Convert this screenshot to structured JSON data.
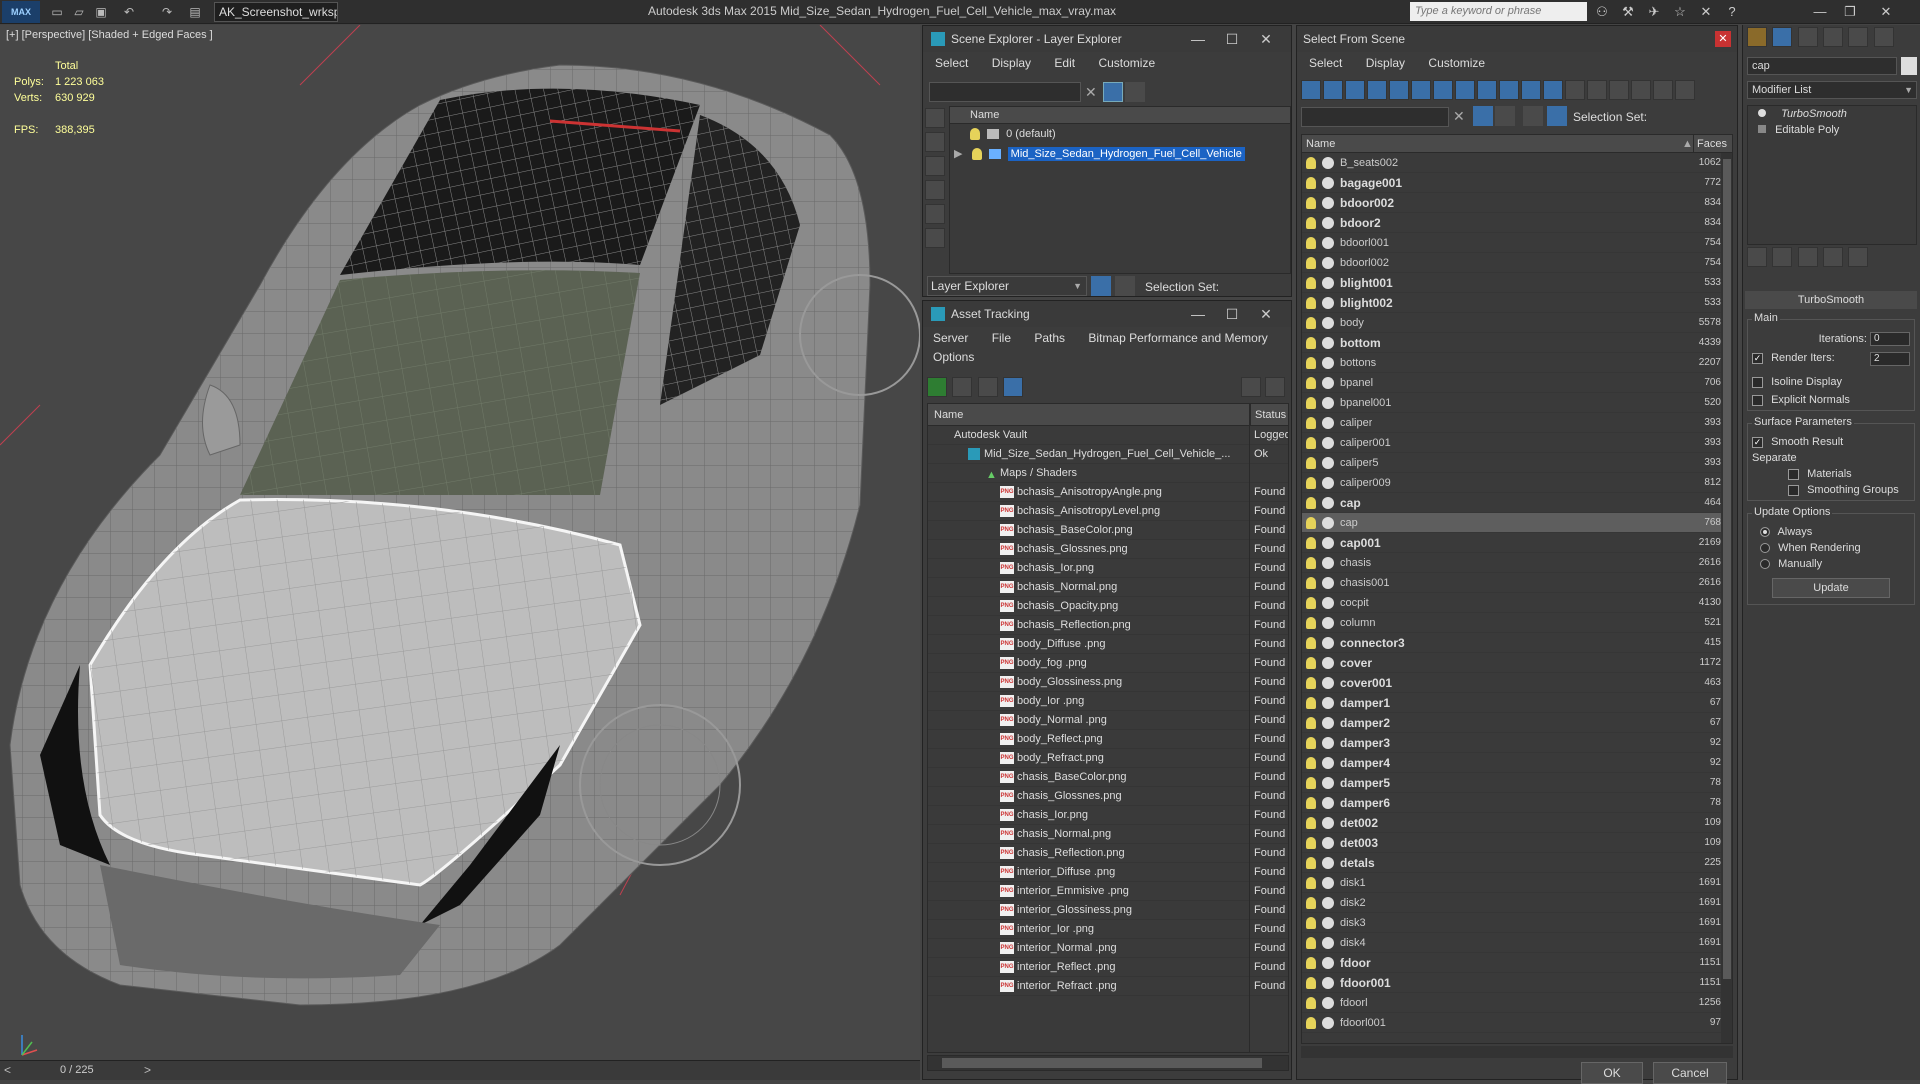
{
  "app": {
    "logo": "MAX",
    "workspace": "AK_Screenshot_wrksp",
    "title": "Autodesk 3ds Max  2015    Mid_Size_Sedan_Hydrogen_Fuel_Cell_Vehicle_max_vray.max",
    "search_placeholder": "Type a keyword or phrase"
  },
  "viewport": {
    "label": "[+] [Perspective] [Shaded + Edged Faces ]",
    "stats": {
      "total_label": "Total",
      "polys_label": "Polys:",
      "polys_value": "1 223 063",
      "verts_label": "Verts:",
      "verts_value": "630 929",
      "fps_label": "FPS:",
      "fps_value": "388,395"
    },
    "timeline": "0 / 225",
    "prev": "<",
    "next": ">"
  },
  "scene_explorer": {
    "title": "Scene Explorer - Layer Explorer",
    "menu": [
      "Select",
      "Display",
      "Edit",
      "Customize"
    ],
    "col_name": "Name",
    "layers": [
      {
        "label": "0 (default)",
        "selected": false
      },
      {
        "label": "Mid_Size_Sedan_Hydrogen_Fuel_Cell_Vehicle",
        "selected": true
      }
    ],
    "explorer_select": "Layer Explorer",
    "selection_set": "Selection Set:"
  },
  "asset_tracking": {
    "title": "Asset Tracking",
    "menu": [
      "Server",
      "File",
      "Paths",
      "Bitmap Performance and Memory"
    ],
    "menu2": "Options",
    "col_name": "Name",
    "col_status": "Status",
    "vault": {
      "name": "Autodesk Vault",
      "status": "Logged"
    },
    "file": {
      "name": "Mid_Size_Sedan_Hydrogen_Fuel_Cell_Vehicle_...",
      "status": "Ok"
    },
    "maps": {
      "name": "Maps / Shaders"
    },
    "png_label": "PNG",
    "items": [
      {
        "name": "bchasis_AnisotropyAngle.png",
        "status": "Found"
      },
      {
        "name": "bchasis_AnisotropyLevel.png",
        "status": "Found"
      },
      {
        "name": "bchasis_BaseColor.png",
        "status": "Found"
      },
      {
        "name": "bchasis_Glossnes.png",
        "status": "Found"
      },
      {
        "name": "bchasis_Ior.png",
        "status": "Found"
      },
      {
        "name": "bchasis_Normal.png",
        "status": "Found"
      },
      {
        "name": "bchasis_Opacity.png",
        "status": "Found"
      },
      {
        "name": "bchasis_Reflection.png",
        "status": "Found"
      },
      {
        "name": "body_Diffuse .png",
        "status": "Found"
      },
      {
        "name": "body_fog .png",
        "status": "Found"
      },
      {
        "name": "body_Glossiness.png",
        "status": "Found"
      },
      {
        "name": "body_Ior .png",
        "status": "Found"
      },
      {
        "name": "body_Normal .png",
        "status": "Found"
      },
      {
        "name": "body_Reflect.png",
        "status": "Found"
      },
      {
        "name": "body_Refract.png",
        "status": "Found"
      },
      {
        "name": "chasis_BaseColor.png",
        "status": "Found"
      },
      {
        "name": "chasis_Glossnes.png",
        "status": "Found"
      },
      {
        "name": "chasis_Ior.png",
        "status": "Found"
      },
      {
        "name": "chasis_Normal.png",
        "status": "Found"
      },
      {
        "name": "chasis_Reflection.png",
        "status": "Found"
      },
      {
        "name": "interior_Diffuse .png",
        "status": "Found"
      },
      {
        "name": "interior_Emmisive .png",
        "status": "Found"
      },
      {
        "name": "interior_Glossiness.png",
        "status": "Found"
      },
      {
        "name": "interior_Ior .png",
        "status": "Found"
      },
      {
        "name": "interior_Normal .png",
        "status": "Found"
      },
      {
        "name": "interior_Reflect .png",
        "status": "Found"
      },
      {
        "name": "interior_Refract .png",
        "status": "Found"
      }
    ]
  },
  "select_from_scene": {
    "title": "Select From Scene",
    "menu": [
      "Select",
      "Display",
      "Customize"
    ],
    "selection_set": "Selection Set:",
    "col_name": "Name",
    "col_faces": "Faces",
    "ok": "OK",
    "cancel": "Cancel",
    "objects": [
      {
        "name": "B_seats002",
        "faces": "1062",
        "bold": false,
        "sel": false
      },
      {
        "name": "bagage001",
        "faces": "772",
        "bold": true,
        "sel": false
      },
      {
        "name": "bdoor002",
        "faces": "834",
        "bold": true,
        "sel": false
      },
      {
        "name": "bdoor2",
        "faces": "834",
        "bold": true,
        "sel": false
      },
      {
        "name": "bdoorl001",
        "faces": "754",
        "bold": false,
        "sel": false
      },
      {
        "name": "bdoorl002",
        "faces": "754",
        "bold": false,
        "sel": false
      },
      {
        "name": "blight001",
        "faces": "533",
        "bold": true,
        "sel": false
      },
      {
        "name": "blight002",
        "faces": "533",
        "bold": true,
        "sel": false
      },
      {
        "name": "body",
        "faces": "5578",
        "bold": false,
        "sel": false
      },
      {
        "name": "bottom",
        "faces": "4339",
        "bold": true,
        "sel": false
      },
      {
        "name": "bottons",
        "faces": "2207",
        "bold": false,
        "sel": false
      },
      {
        "name": "bpanel",
        "faces": "706",
        "bold": false,
        "sel": false
      },
      {
        "name": "bpanel001",
        "faces": "520",
        "bold": false,
        "sel": false
      },
      {
        "name": "caliper",
        "faces": "393",
        "bold": false,
        "sel": false
      },
      {
        "name": "caliper001",
        "faces": "393",
        "bold": false,
        "sel": false
      },
      {
        "name": "caliper5",
        "faces": "393",
        "bold": false,
        "sel": false
      },
      {
        "name": "caliper009",
        "faces": "812",
        "bold": false,
        "sel": false
      },
      {
        "name": "cap",
        "faces": "464",
        "bold": true,
        "sel": false
      },
      {
        "name": "cap",
        "faces": "768",
        "bold": false,
        "sel": true
      },
      {
        "name": "cap001",
        "faces": "2169",
        "bold": true,
        "sel": false
      },
      {
        "name": "chasis",
        "faces": "2616",
        "bold": false,
        "sel": false
      },
      {
        "name": "chasis001",
        "faces": "2616",
        "bold": false,
        "sel": false
      },
      {
        "name": "cocpit",
        "faces": "4130",
        "bold": false,
        "sel": false
      },
      {
        "name": "column",
        "faces": "521",
        "bold": false,
        "sel": false
      },
      {
        "name": "connector3",
        "faces": "415",
        "bold": true,
        "sel": false
      },
      {
        "name": "cover",
        "faces": "1172",
        "bold": true,
        "sel": false
      },
      {
        "name": "cover001",
        "faces": "463",
        "bold": true,
        "sel": false
      },
      {
        "name": "damper1",
        "faces": "67",
        "bold": true,
        "sel": false
      },
      {
        "name": "damper2",
        "faces": "67",
        "bold": true,
        "sel": false
      },
      {
        "name": "damper3",
        "faces": "92",
        "bold": true,
        "sel": false
      },
      {
        "name": "damper4",
        "faces": "92",
        "bold": true,
        "sel": false
      },
      {
        "name": "damper5",
        "faces": "78",
        "bold": true,
        "sel": false
      },
      {
        "name": "damper6",
        "faces": "78",
        "bold": true,
        "sel": false
      },
      {
        "name": "det002",
        "faces": "109",
        "bold": true,
        "sel": false
      },
      {
        "name": "det003",
        "faces": "109",
        "bold": true,
        "sel": false
      },
      {
        "name": "detals",
        "faces": "225",
        "bold": true,
        "sel": false
      },
      {
        "name": "disk1",
        "faces": "1691",
        "bold": false,
        "sel": false
      },
      {
        "name": "disk2",
        "faces": "1691",
        "bold": false,
        "sel": false
      },
      {
        "name": "disk3",
        "faces": "1691",
        "bold": false,
        "sel": false
      },
      {
        "name": "disk4",
        "faces": "1691",
        "bold": false,
        "sel": false
      },
      {
        "name": "fdoor",
        "faces": "1151",
        "bold": true,
        "sel": false
      },
      {
        "name": "fdoor001",
        "faces": "1151",
        "bold": true,
        "sel": false
      },
      {
        "name": "fdoorl",
        "faces": "1256",
        "bold": false,
        "sel": false
      },
      {
        "name": "fdoorl001",
        "faces": "97",
        "bold": false,
        "sel": false
      }
    ]
  },
  "command_panel": {
    "name_field": "cap",
    "modifier_list": "Modifier List",
    "stack": [
      "TurboSmooth",
      "Editable Poly"
    ],
    "rollout": "TurboSmooth",
    "main_group": "Main",
    "iterations_label": "Iterations:",
    "iterations_value": "0",
    "render_iters_label": "Render Iters:",
    "render_iters_value": "2",
    "isoline": "Isoline Display",
    "explicit": "Explicit Normals",
    "surface_group": "Surface Parameters",
    "smooth_result": "Smooth Result",
    "separate": "Separate",
    "materials": "Materials",
    "smoothing_groups": "Smoothing Groups",
    "update_group": "Update Options",
    "always": "Always",
    "when_rendering": "When Rendering",
    "manually": "Manually",
    "update_btn": "Update"
  },
  "colors": {
    "selection_blue": "#1b63c4",
    "status_text": "#ffff9a",
    "bulb": "#e6d35a"
  }
}
